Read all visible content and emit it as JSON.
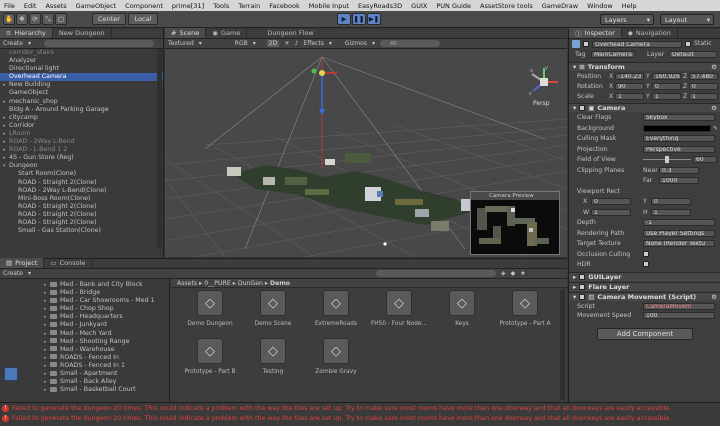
{
  "menu": [
    "File",
    "Edit",
    "Assets",
    "GameObject",
    "Component",
    "prime[31]",
    "Tools",
    "Terrain",
    "Facebook",
    "Mobile Input",
    "EasyRoads3D",
    "GUIX",
    "PUN Guide",
    "AssetStore tools",
    "GameDraw",
    "Window",
    "Help"
  ],
  "toolbar": {
    "center_label": "Center",
    "local_label": "Local",
    "layers_label": "Layers",
    "layout_label": "Layout"
  },
  "hierarchy": {
    "tab_label": "Hierarchy",
    "scene_name": "New Dungeon",
    "create_label": "Create",
    "items": [
      {
        "label": "corridor_stairs",
        "state": "dim"
      },
      {
        "label": "Analyzer",
        "state": ""
      },
      {
        "label": "Directional light",
        "state": ""
      },
      {
        "label": "Overhead Camera",
        "state": "sel"
      },
      {
        "label": "New Building",
        "state": "arrow"
      },
      {
        "label": "GameObject",
        "state": ""
      },
      {
        "label": "mechanic_shop",
        "state": "arrow"
      },
      {
        "label": "Bldg A - Around Parking Garage",
        "state": ""
      },
      {
        "label": "citycamp",
        "state": "arrow"
      },
      {
        "label": "Corridor",
        "state": "arrow"
      },
      {
        "label": "LRoom",
        "state": "dimarrow"
      },
      {
        "label": "ROAD - 2Way L-Bend",
        "state": "dimarrow"
      },
      {
        "label": "ROAD - L-Bend 1 2",
        "state": "dimarrow"
      },
      {
        "label": "4S - Gun Store (Reg)",
        "state": "arrow"
      },
      {
        "label": "Dungeon",
        "state": "open"
      },
      {
        "label": "Start Room(Clone)",
        "state": "child"
      },
      {
        "label": "ROAD - Straight 2(Clone)",
        "state": "child"
      },
      {
        "label": "ROAD - 2Way L-Bend(Clone)",
        "state": "child"
      },
      {
        "label": "Mini-Boss Room(Clone)",
        "state": "child"
      },
      {
        "label": "ROAD - Straight 2(Clone)",
        "state": "child"
      },
      {
        "label": "ROAD - Straight 2(Clone)",
        "state": "child"
      },
      {
        "label": "ROAD - Straight 2(Clone)",
        "state": "child"
      },
      {
        "label": "Small - Gas Station(Clone)",
        "state": "child"
      }
    ]
  },
  "scene": {
    "tab_scene": "Scene",
    "tab_game": "Game",
    "flow_tab": "Dungeon Flow",
    "shading": "Textured",
    "render": "RGB",
    "mode_2d": "2D",
    "effects": "Effects",
    "gizmos": "Gizmos",
    "all": "All",
    "persp_label": "Persp",
    "preview_title": "Camera Preview",
    "axis_x": "x",
    "axis_y": "y",
    "axis_z": "z"
  },
  "project": {
    "tab_project": "Project",
    "tab_console": "Console",
    "create_label": "Create",
    "breadcrumb": [
      "Assets",
      "0__PURE",
      "DunGen",
      "Demo"
    ],
    "folders": [
      "Med - Bank and City Block",
      "Med - Bridge",
      "Med - Car Showrooms - Med 1",
      "Med - Chop Shop",
      "Med - Headquarters",
      "Med - Junkyard",
      "Med - Mech Yard",
      "Med - Shooting Range",
      "Med - Warehouse",
      "ROADS - Fenced In",
      "ROADS - Fenced In 1",
      "Small - Apartment",
      "Small - Back Alley",
      "Small - Basketball Court"
    ],
    "assets_row1": [
      "Demo Dungeon",
      "Demo Scene",
      "ExtremeRoads",
      "FH50 - Four Node...",
      "Keys",
      "Prototype - Part A"
    ],
    "assets_row2": [
      "Prototype - Part B",
      "Testing",
      "Zombie Gravy"
    ]
  },
  "inspector": {
    "tab_inspector": "Inspector",
    "tab_navigation": "Navigation",
    "object_name": "Overhead Camera",
    "static_label": "Static",
    "tag_label": "Tag",
    "tag_value": "MainCamera",
    "layer_label": "Layer",
    "layer_value": "Default",
    "transform": {
      "title": "Transform",
      "position": {
        "label": "Position",
        "x": "-140.23",
        "y": "160.926",
        "z": "57.480"
      },
      "rotation": {
        "label": "Rotation",
        "x": "90",
        "y": "0",
        "z": "0"
      },
      "scale": {
        "label": "Scale",
        "x": "1",
        "y": "1",
        "z": "1"
      }
    },
    "camera": {
      "title": "Camera",
      "rows": [
        {
          "label": "Clear Flags",
          "value": "Skybox"
        },
        {
          "label": "Background",
          "value": ""
        },
        {
          "label": "Culling Mask",
          "value": "Everything"
        },
        {
          "label": "Projection",
          "value": "Perspective"
        },
        {
          "label": "Field of View",
          "value": "60"
        },
        {
          "label": "Clipping Planes",
          "value": ""
        },
        {
          "label": "",
          "value": ""
        },
        {
          "label": "Viewport Rect",
          "value": ""
        },
        {
          "label": "",
          "value": ""
        },
        {
          "label": "",
          "value": ""
        },
        {
          "label": "Depth",
          "value": "-1"
        },
        {
          "label": "Rendering Path",
          "value": "Use Player Settings"
        },
        {
          "label": "Target Texture",
          "value": "None (Render Textu"
        },
        {
          "label": "Occlusion Culling",
          "value": ""
        },
        {
          "label": "HDR",
          "value": ""
        }
      ],
      "near_label": "Near",
      "near_value": "0.3",
      "far_label": "Far",
      "far_value": "1000",
      "vx_label": "X",
      "vx_value": "0",
      "vy_label": "Y",
      "vy_value": "0",
      "vw_label": "W",
      "vw_value": "1",
      "vh_label": "H",
      "vh_value": "1"
    },
    "guilayer": "GUILayer",
    "flarelayer": "Flare Layer",
    "movement": {
      "title": "Camera Movement (Script)",
      "script_label": "Script",
      "script_value": "CameraMovem",
      "speed_label": "Movement Speed",
      "speed_value": "100"
    },
    "add_component": "Add Component"
  },
  "console": {
    "errors": [
      "Failed to generate the dungeon 20 times. This could indicate a problem with the way the tiles are set up. Try to make sure most rooms have more than one doorway and that all doorways are easily accessible.",
      "Failed to generate the dungeon 20 times. This could indicate a problem with the way the tiles are set up. Try to make sure most rooms have more than one doorway and that all doorways are easily accessible."
    ]
  },
  "colors": {
    "selection": "#3a5fa8",
    "error": "#e0403a",
    "play": "#5d83c4"
  }
}
